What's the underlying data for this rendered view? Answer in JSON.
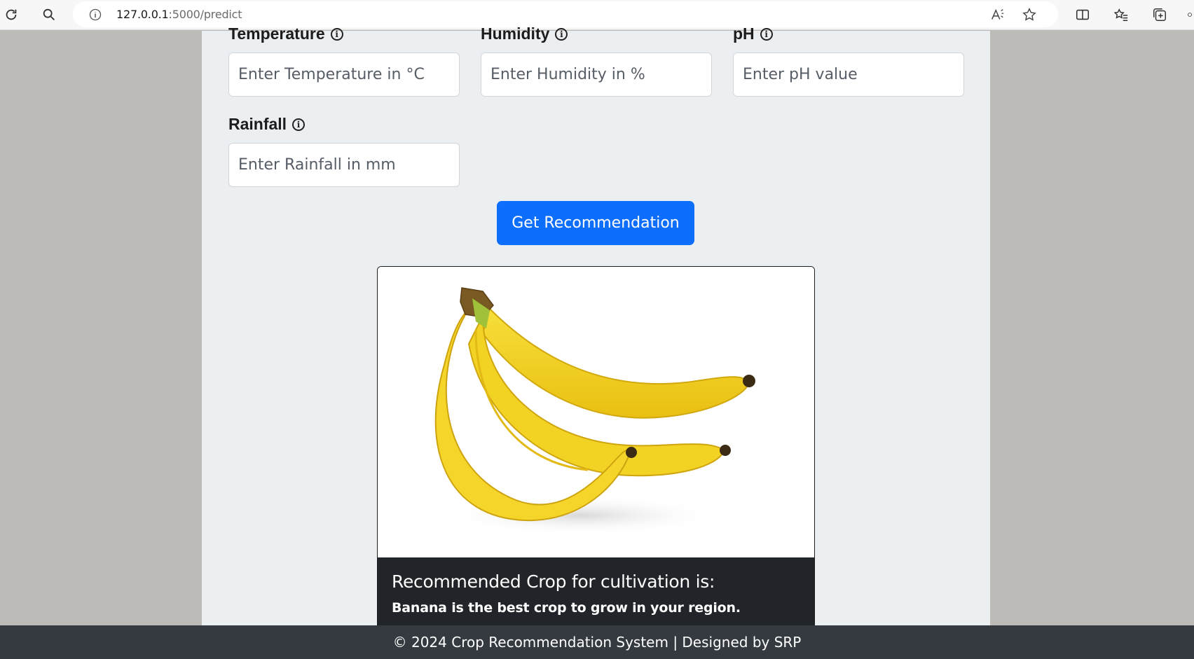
{
  "browser": {
    "url_host": "127.0.0.1",
    "url_path": ":5000/predict"
  },
  "fields": {
    "temperature": {
      "label": "Temperature",
      "placeholder": "Enter Temperature in °C"
    },
    "humidity": {
      "label": "Humidity",
      "placeholder": "Enter Humidity in %"
    },
    "ph": {
      "label": "pH",
      "placeholder": "Enter pH value"
    },
    "rainfall": {
      "label": "Rainfall",
      "placeholder": "Enter Rainfall in mm"
    }
  },
  "info_icon_glyph": "i",
  "button": {
    "label": "Get Recommendation"
  },
  "result": {
    "title": "Recommended Crop for cultivation is:",
    "text": "Banana is the best crop to grow in your region."
  },
  "footer": {
    "text": "© 2024 Crop Recommendation System | Designed by SRP"
  },
  "colors": {
    "primary": "#0d6efd",
    "card_dark": "#212529",
    "footer": "#343a40",
    "banana": "#f4d21a"
  }
}
